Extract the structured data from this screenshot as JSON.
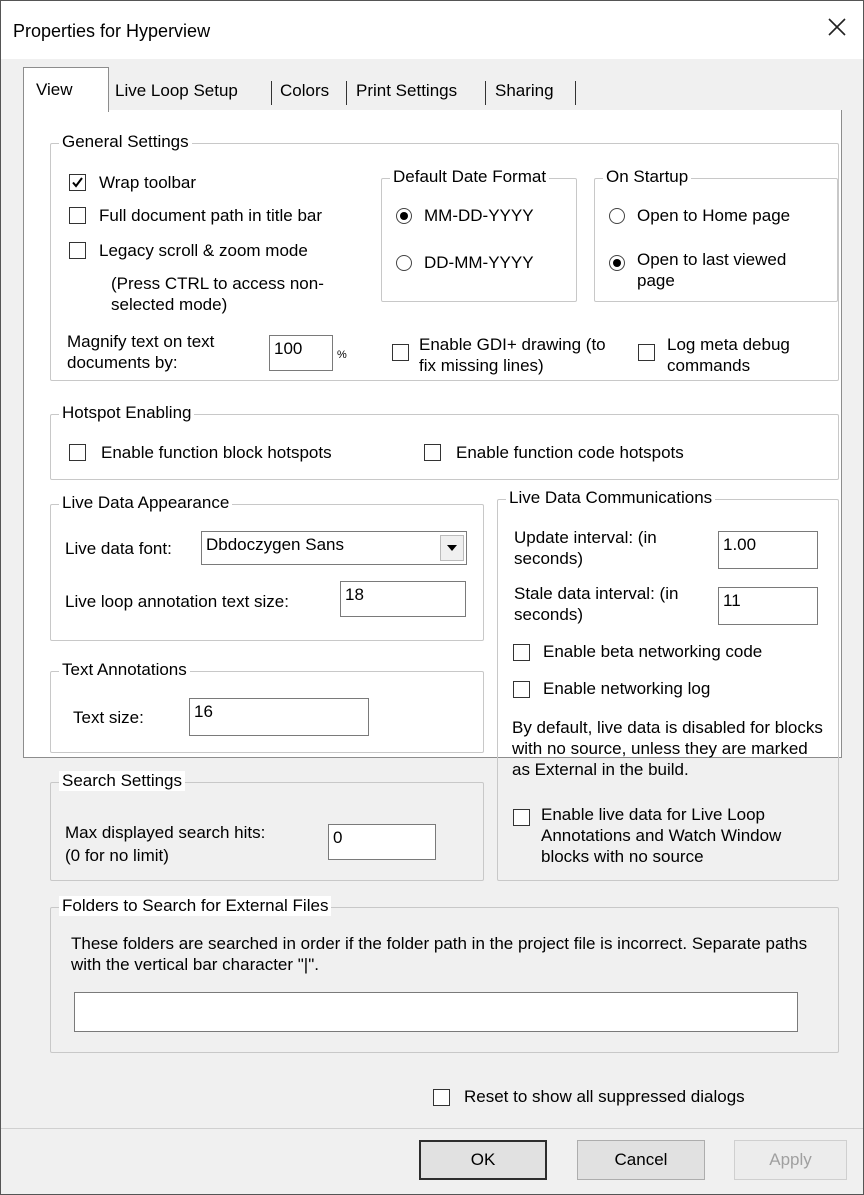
{
  "window": {
    "title": "Properties for Hyperview"
  },
  "tabs": [
    "View",
    "Live Loop Setup",
    "Colors",
    "Print Settings",
    "Sharing"
  ],
  "general": {
    "title": "General Settings",
    "wrap_toolbar": {
      "label": "Wrap toolbar",
      "checked": true
    },
    "full_path": {
      "label": "Full document path in title bar",
      "checked": false
    },
    "legacy_scroll": {
      "label": "Legacy scroll & zoom mode",
      "checked": false
    },
    "legacy_note": "(Press CTRL to access non-selected mode)",
    "magnify_label": "Magnify text on text documents by:",
    "magnify_value": "100",
    "magnify_unit": "%",
    "gdi": {
      "label": "Enable GDI+ drawing (to fix missing lines)",
      "checked": false
    },
    "log_meta": {
      "label": "Log meta debug commands",
      "checked": false
    },
    "date_format": {
      "title": "Default Date Format",
      "options": [
        "MM-DD-YYYY",
        "DD-MM-YYYY"
      ],
      "selected": "MM-DD-YYYY"
    },
    "startup": {
      "title": "On Startup",
      "options": [
        "Open to Home page",
        "Open to last viewed page"
      ],
      "selected": "Open to last viewed page"
    }
  },
  "hotspot": {
    "title": "Hotspot Enabling",
    "block": {
      "label": "Enable function block hotspots",
      "checked": false
    },
    "code": {
      "label": "Enable function code hotspots",
      "checked": false
    }
  },
  "live_appearance": {
    "title": "Live Data Appearance",
    "font_label": "Live data font:",
    "font_value": "Dbdoczygen Sans",
    "annotation_label": "Live loop annotation text size:",
    "annotation_value": "18"
  },
  "text_annotations": {
    "title": "Text Annotations",
    "size_label": "Text size:",
    "size_value": "16"
  },
  "search": {
    "title": "Search Settings",
    "max_label": "Max displayed search hits:",
    "max_sub": "(0 for no limit)",
    "max_value": "0"
  },
  "live_comm": {
    "title": "Live Data Communications",
    "update_label": "Update interval: (in seconds)",
    "update_value": "1.00",
    "stale_label": "Stale data interval: (in seconds)",
    "stale_value": "11",
    "beta": {
      "label": "Enable beta networking code",
      "checked": false
    },
    "netlog": {
      "label": "Enable networking log",
      "checked": false
    },
    "note": "By default, live data is disabled for blocks with no source, unless they are marked as External in the build.",
    "enable_live": {
      "label": "Enable live data for Live Loop Annotations and Watch Window blocks with no source",
      "checked": false
    }
  },
  "folders": {
    "title": "Folders to Search for External Files",
    "desc": "These folders are searched in order if the folder path in the project file is incorrect. Separate paths with the vertical bar character \"|\".",
    "value": ""
  },
  "reset": {
    "label": "Reset to show all suppressed dialogs",
    "checked": false
  },
  "buttons": {
    "ok": "OK",
    "cancel": "Cancel",
    "apply": "Apply"
  }
}
